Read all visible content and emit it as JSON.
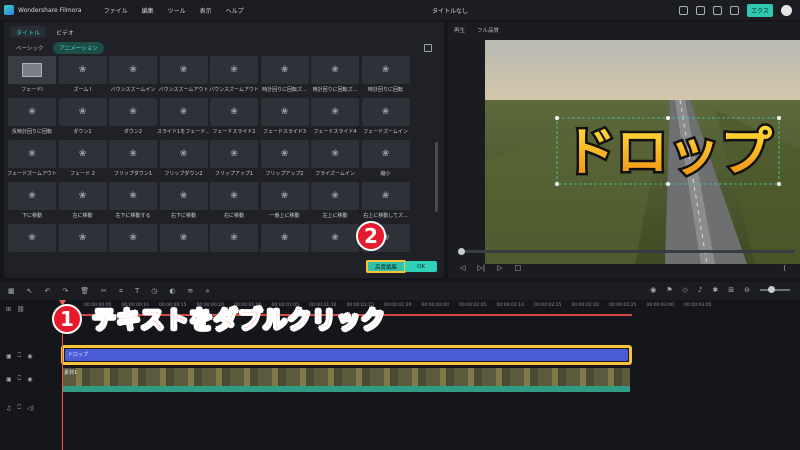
{
  "app": {
    "name": "Wondershare Filmora",
    "doc_title": "タイトルなし",
    "export_label": "エクス"
  },
  "menu": [
    "ファイル",
    "編集",
    "ツール",
    "表示",
    "ヘルプ"
  ],
  "left_panel": {
    "tabs": [
      {
        "label": "タイトル",
        "active": true
      },
      {
        "label": "ビデオ",
        "active": false
      }
    ],
    "subtabs": [
      {
        "label": "ベーシック",
        "active": false
      },
      {
        "label": "アニメーション",
        "active": true
      }
    ],
    "animations": [
      "フェードI",
      "ズーム I",
      "バウンスズームイン",
      "バウンスズームアウト",
      "バウンスズームアウト",
      "時計回りに回転ズ...",
      "時計回りに回転ズ...",
      "時計回りに回転",
      "反時計回りに回転",
      "ダウン1",
      "ダウン2",
      "スライド1をフェード...",
      "フェードスライド2",
      "フェードスライド3",
      "フェードスライド4",
      "フェードズームイン",
      "フェードズームアウト",
      "フェード 2",
      "フリップダウン1",
      "フリップダウン2",
      "フリップアップ1",
      "フリップアップ2",
      "フライズームイン",
      "縮小",
      "下に移動",
      "左に移動",
      "左下に移動する",
      "右下に移動",
      "右に移動",
      "一番上に移動",
      "左上に移動",
      "右上に移動してズ...",
      "",
      "",
      "",
      "",
      "",
      "",
      "",
      ""
    ],
    "advanced_button": "高度編集",
    "ok_button": "OK"
  },
  "preview": {
    "tabs": [
      "再生",
      "フル品質"
    ],
    "overlay_text": "ドロップ"
  },
  "timeline": {
    "ruler": [
      "00:00:00:05",
      "00:00:00:10",
      "00:00:00:15",
      "00:00:00:20",
      "00:00:01:00",
      "00:00:01:05",
      "00:00:01:10",
      "00:00:01:15",
      "00:00:01:20",
      "00:00:02:00",
      "00:00:02:05",
      "00:00:02:10",
      "00:00:02:15",
      "00:00:02:20",
      "00:00:02:25",
      "00:00:03:00",
      "00:00:03:05"
    ],
    "title_clip_label": "ドロップ",
    "video_clip_label": "素材1",
    "instruction": "テキストをダブルクリック"
  },
  "annotations": {
    "badge1": "1",
    "badge2": "2"
  },
  "colors": {
    "accent": "#2ec8b0",
    "highlight": "#f5c438",
    "badge": "#e6192d",
    "title_clip": "#4b5bd6"
  }
}
